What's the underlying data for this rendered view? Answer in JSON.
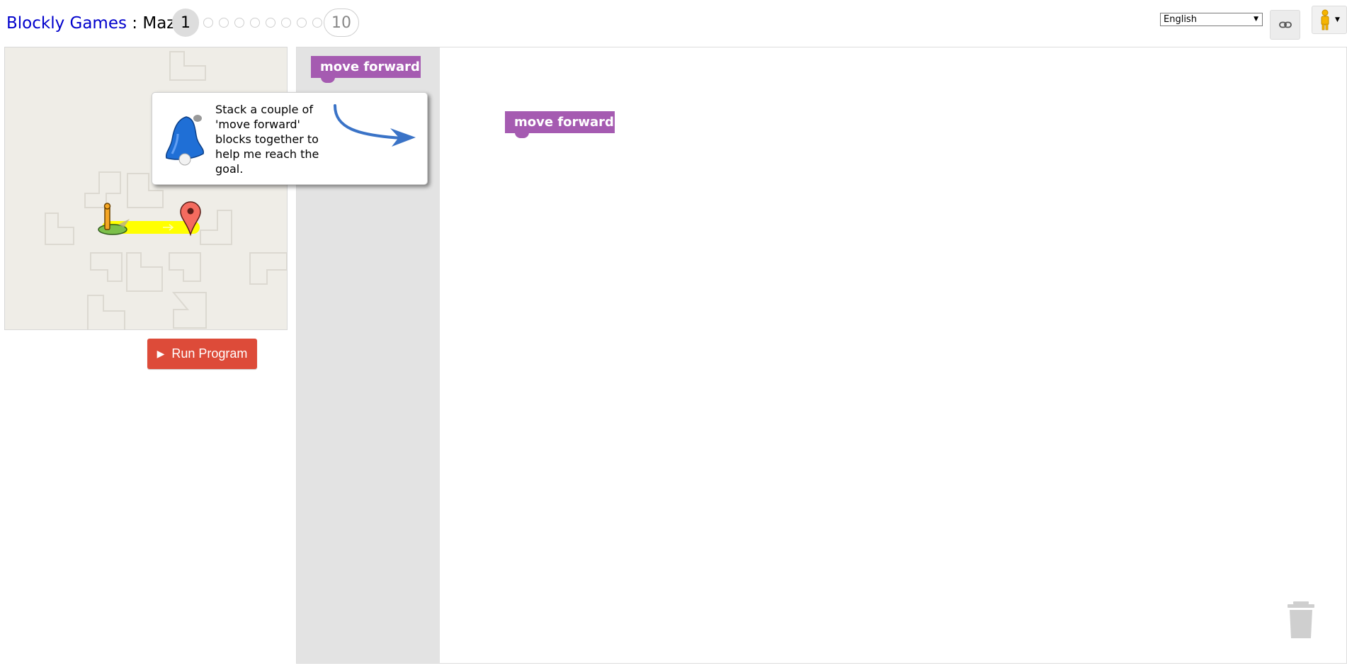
{
  "header": {
    "app_name": "Blockly Games",
    "separator": " : ",
    "game_name": "Maze",
    "current_level": "1",
    "last_level": "10",
    "language": "English"
  },
  "icons": {
    "link": "link-icon",
    "user": "user-icon",
    "bell": "bell-icon",
    "trash": "trash-icon",
    "play": "play-icon"
  },
  "run_button": {
    "label": "Run Program"
  },
  "toolbox": {
    "blocks": [
      "move forward"
    ]
  },
  "workspace": {
    "blocks": [
      "move forward"
    ]
  },
  "hint": {
    "text": "Stack a couple of 'move forward' blocks together to help me reach the goal."
  },
  "colors": {
    "block": "#a55bb1",
    "run_button": "#dd4b39",
    "path": "#ffff00",
    "link": "#0000cc"
  }
}
